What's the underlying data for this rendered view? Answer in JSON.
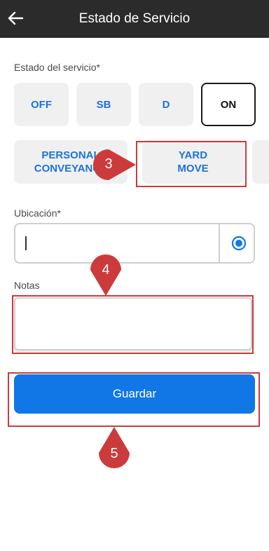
{
  "header": {
    "title": "Estado de Servicio",
    "back_icon": "arrow-left-icon"
  },
  "status": {
    "label": "Estado del servicio*",
    "options": [
      "OFF",
      "SB",
      "D",
      "ON"
    ],
    "selected": "ON"
  },
  "special": {
    "personal_line1": "PERSONAL",
    "personal_line2": "CONVEYANCE",
    "yard_line1": "YARD",
    "yard_line2": "MOVE"
  },
  "location": {
    "label": "Ubicación*",
    "value": "",
    "locate_icon": "radio-target-icon"
  },
  "notes": {
    "label": "Notas",
    "value": ""
  },
  "save": {
    "label": "Guardar"
  },
  "annotations": {
    "marker3": "3",
    "marker4": "4",
    "marker5": "5",
    "color": "#cc3b3b"
  },
  "colors": {
    "header_bg": "#2b2b2b",
    "accent": "#1177e6",
    "option_text": "#1a73d9"
  }
}
